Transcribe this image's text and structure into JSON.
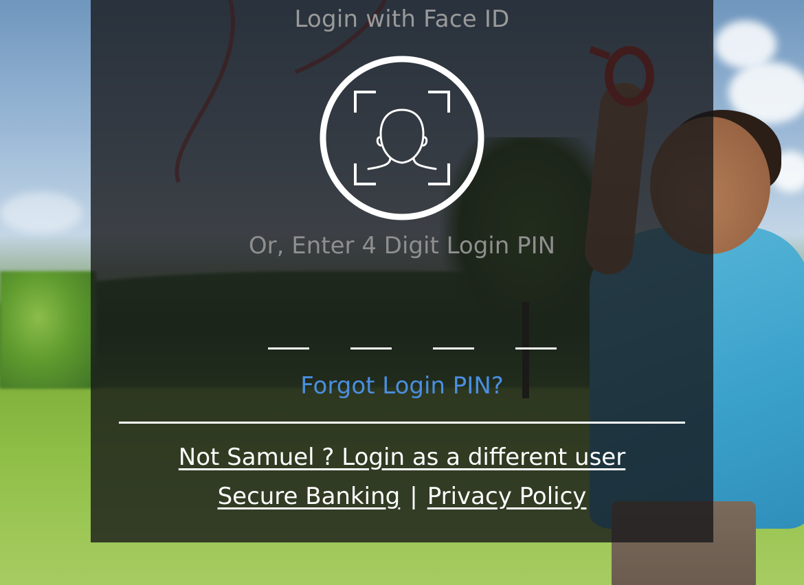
{
  "login": {
    "faceid_title": "Login with Face ID",
    "faceid_icon": "face-id-icon",
    "pin_title": "Or, Enter 4 Digit Login PIN",
    "pin_length": 4,
    "pin_values": [
      "",
      "",
      "",
      ""
    ],
    "forgot_pin_label": "Forgot Login PIN?",
    "switch_user_label": "Not Samuel ? Login as a different user",
    "footer": {
      "secure_banking_label": "Secure Banking",
      "separator": "|",
      "privacy_policy_label": "Privacy Policy"
    }
  },
  "colors": {
    "panel_overlay": "#161618",
    "title_text": "#9a9a9a",
    "link_accent": "#4a8fe0",
    "text_white": "#ffffff"
  }
}
